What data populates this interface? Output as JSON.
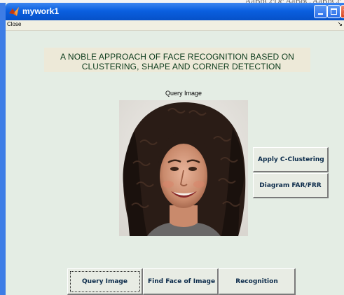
{
  "background": {
    "text": "AaBbCcDc AaBbC AaBbCc"
  },
  "window": {
    "title": "mywork1",
    "menu": {
      "close_label": "Close",
      "arrow": "↘"
    }
  },
  "heading": {
    "line1": "A NOBLE APPROACH OF FACE RECOGNITION BASED ON",
    "line2": "CLUSTERING, SHAPE AND CORNER DETECTION"
  },
  "query_image_label": "Query Image",
  "side_buttons": {
    "apply_clustering": "Apply C-Clustering",
    "diagram": "Diagram FAR/FRR"
  },
  "bottom_buttons": {
    "query_image": "Query Image",
    "find_face": "Find Face of Image",
    "recognition": "Recognition"
  },
  "colors": {
    "titlebar": "#0a5fe0",
    "window_bg": "#e4ede4",
    "heading_panel": "#ede9d8",
    "button_text": "#0a2a4a"
  },
  "icons": [
    "matlab-app-icon",
    "minimize-icon",
    "maximize-icon",
    "close-icon",
    "menu-arrow-icon"
  ]
}
